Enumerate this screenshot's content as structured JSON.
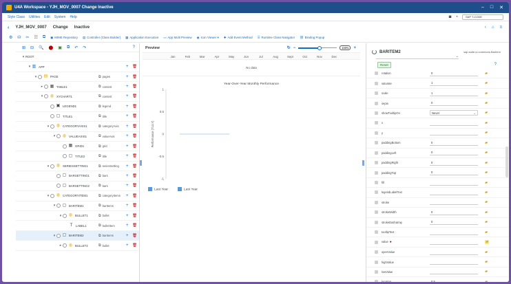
{
  "window": {
    "title": "U4A Workspace - YJH_MOV_0007 Change Inactive",
    "controls": [
      "–",
      "□",
      "✕"
    ]
  },
  "menubar": {
    "items": [
      "Style Class",
      "Utilities",
      "Edit",
      "System",
      "Help"
    ],
    "tcode_label": "SAP T-CODE"
  },
  "header": {
    "app_id": "YJH_MOV_0007",
    "mode": "Change",
    "status": "Inactive",
    "right_icons": [
      "‹",
      "⌂",
      "≡"
    ]
  },
  "app_toolbar": {
    "icons": [
      "⚙",
      "⛁",
      "✂",
      "☷",
      "⧉"
    ],
    "buttons": [
      {
        "icon": "▣",
        "label": "MIME Repository"
      },
      {
        "icon": "▤",
        "label": "Controller (Class Builder)"
      },
      {
        "icon": "▦",
        "label": "Application Execution"
      },
      {
        "icon": "▭",
        "label": "App Multi Preview"
      },
      {
        "icon": "◉",
        "label": "Icon Viewer ▾"
      },
      {
        "icon": "✚",
        "label": "Add Event Method"
      },
      {
        "icon": "☰",
        "label": "Runtime Class Navigator"
      },
      {
        "icon": "⛓",
        "label": "Binding Popup"
      }
    ]
  },
  "tree_toolbar": {
    "icons": [
      "⊞",
      "⊟",
      "🔍",
      "⬤",
      "▣",
      "⧉",
      "↶",
      "↷"
    ],
    "help": "?"
  },
  "tree": [
    {
      "indent": 0,
      "caret": "▾",
      "check": false,
      "icon": "",
      "icon_class": "",
      "name": "ROOT",
      "agg": "",
      "actions": false,
      "selected": false
    },
    {
      "indent": 1,
      "caret": "▾",
      "check": false,
      "icon": "▥",
      "icon_class": "ico-sap",
      "name": "APP",
      "agg": "",
      "actions": true,
      "selected": false
    },
    {
      "indent": 2,
      "caret": "▾",
      "check": true,
      "icon": "▤",
      "icon_class": "ico-yellow",
      "name": "PAGE",
      "agg": "pages",
      "actions": true,
      "selected": false
    },
    {
      "indent": 3,
      "caret": "▸",
      "check": true,
      "icon": "▦",
      "icon_class": "ico-dark",
      "name": "TABLE1",
      "agg": "content",
      "actions": true,
      "selected": false
    },
    {
      "indent": 3,
      "caret": "▾",
      "check": true,
      "icon": "◍",
      "icon_class": "ico-yellow",
      "name": "XYCHART1",
      "agg": "content",
      "actions": true,
      "selected": false
    },
    {
      "indent": 4,
      "caret": "",
      "check": true,
      "icon": "▣",
      "icon_class": "ico-dark",
      "name": "LEGEND1",
      "agg": "legend",
      "actions": true,
      "selected": false
    },
    {
      "indent": 4,
      "caret": "",
      "check": true,
      "icon": "▢",
      "icon_class": "ico-dark",
      "name": "TITLE1",
      "agg": "title",
      "actions": true,
      "selected": false
    },
    {
      "indent": 4,
      "caret": "▾",
      "check": true,
      "icon": "◍",
      "icon_class": "ico-yellow",
      "name": "CATEGORYAXIS1",
      "agg": "categoryAxis",
      "actions": true,
      "selected": false
    },
    {
      "indent": 5,
      "caret": "▾",
      "check": true,
      "icon": "◍",
      "icon_class": "ico-yellow",
      "name": "VALUEAXIS1",
      "agg": "valueAxis",
      "actions": true,
      "selected": false
    },
    {
      "indent": 6,
      "caret": "",
      "check": true,
      "icon": "▦",
      "icon_class": "ico-dark",
      "name": "GRID1",
      "agg": "grid",
      "actions": true,
      "selected": false
    },
    {
      "indent": 6,
      "caret": "",
      "check": true,
      "icon": "▢",
      "icon_class": "ico-dark",
      "name": "TITLE2",
      "agg": "title",
      "actions": true,
      "selected": false
    },
    {
      "indent": 4,
      "caret": "▾",
      "check": true,
      "icon": "◍",
      "icon_class": "ico-yellow",
      "name": "SERIESSETTING1",
      "agg": "seriesSetting",
      "actions": true,
      "selected": false
    },
    {
      "indent": 5,
      "caret": "",
      "check": true,
      "icon": "▢",
      "icon_class": "ico-dark",
      "name": "BARSETTING1",
      "agg": "bars",
      "actions": true,
      "selected": false
    },
    {
      "indent": 5,
      "caret": "",
      "check": true,
      "icon": "▢",
      "icon_class": "ico-dark",
      "name": "BARSETTING2",
      "agg": "bars",
      "actions": true,
      "selected": false
    },
    {
      "indent": 4,
      "caret": "▾",
      "check": true,
      "icon": "◍",
      "icon_class": "ico-yellow",
      "name": "CATEGORYITEM1",
      "agg": "categoryItems",
      "actions": true,
      "selected": false
    },
    {
      "indent": 5,
      "caret": "▾",
      "check": true,
      "icon": "▢",
      "icon_class": "ico-dark",
      "name": "BARITEM1",
      "agg": "barItems",
      "actions": true,
      "selected": false
    },
    {
      "indent": 6,
      "caret": "▾",
      "check": true,
      "icon": "◍",
      "icon_class": "ico-yellow",
      "name": "BULLET1",
      "agg": "bullet",
      "actions": true,
      "selected": false
    },
    {
      "indent": 7,
      "caret": "",
      "check": false,
      "icon": "T",
      "icon_class": "ico-dark",
      "name": "LABEL1",
      "agg": "bulletItem",
      "actions": true,
      "selected": false
    },
    {
      "indent": 5,
      "caret": "▾",
      "check": true,
      "icon": "▢",
      "icon_class": "ico-dark",
      "name": "BARITEM2",
      "agg": "barItems",
      "actions": true,
      "selected": true
    },
    {
      "indent": 6,
      "caret": "▸",
      "check": true,
      "icon": "◍",
      "icon_class": "ico-yellow",
      "name": "BULLET2",
      "agg": "bullet",
      "actions": true,
      "selected": false
    }
  ],
  "preview": {
    "title": "Preview",
    "zoom_label": "100%",
    "zoom_fraction": 0.55,
    "months": [
      "Jan",
      "Feb",
      "Mar",
      "Apr",
      "May",
      "Jun",
      "Jul",
      "Aug",
      "Sept",
      "Oct",
      "Nov",
      "Dec"
    ],
    "no_data": "No data"
  },
  "chart_data": {
    "type": "bar",
    "title": "Year-Over-Year Monthly Performance",
    "ylabel": "Performance (\\ud83d\\udcc8) (\\ud83d\\udccf)",
    "ylabel_display": "Performance (TL/LY)",
    "yticks": [
      1.0,
      0.5,
      0,
      -0.5,
      -1.0
    ],
    "ylim": [
      -1.0,
      1.0
    ],
    "categories": [],
    "series": [
      {
        "name": "Last Year",
        "values": []
      },
      {
        "name": "Last Year",
        "values": []
      }
    ],
    "legend_entries": [
      "Last Year",
      "Last Year"
    ],
    "legend_color": "#5899da",
    "zero_line_color": "#9ec3ea"
  },
  "properties_panel": {
    "title": "BARITEM2",
    "subtitle": "sap.suite.ui.commons.BarItem",
    "reset_label": "Reset",
    "help": "?",
    "rows": [
      {
        "name": "rotation",
        "value": "0",
        "type": "input",
        "required": false,
        "highlight": false
      },
      {
        "name": "saturate",
        "value": "1",
        "type": "input",
        "required": false,
        "highlight": false
      },
      {
        "name": "scale",
        "value": "1",
        "type": "input",
        "required": false,
        "highlight": false
      },
      {
        "name": "sepia",
        "value": "0",
        "type": "input",
        "required": false,
        "highlight": false
      },
      {
        "name": "showTooltipOn",
        "value": "Never",
        "type": "select",
        "required": false,
        "highlight": false
      },
      {
        "name": "x",
        "value": "",
        "type": "input",
        "required": false,
        "highlight": false
      },
      {
        "name": "y",
        "value": "",
        "type": "input",
        "required": false,
        "highlight": false
      },
      {
        "name": "paddingBottom",
        "value": "0",
        "type": "input",
        "required": false,
        "highlight": false
      },
      {
        "name": "paddingLeft",
        "value": "0",
        "type": "input",
        "required": false,
        "highlight": false
      },
      {
        "name": "paddingRight",
        "value": "0",
        "type": "input",
        "required": false,
        "highlight": false
      },
      {
        "name": "paddingTop",
        "value": "0",
        "type": "input",
        "required": false,
        "highlight": false
      },
      {
        "name": "fill",
        "value": "",
        "type": "input",
        "required": false,
        "highlight": false
      },
      {
        "name": "legendLabelText",
        "value": "",
        "type": "input",
        "required": false,
        "highlight": false
      },
      {
        "name": "stroke",
        "value": "",
        "type": "input",
        "required": false,
        "highlight": false
      },
      {
        "name": "strokeWidth",
        "value": "0",
        "type": "input",
        "required": false,
        "highlight": false
      },
      {
        "name": "strokeDasharray",
        "value": "0",
        "type": "input",
        "required": false,
        "highlight": false
      },
      {
        "name": "tooltipText",
        "value": "",
        "type": "input",
        "required": false,
        "highlight": false
      },
      {
        "name": "value",
        "value": "",
        "type": "input",
        "required": true,
        "highlight": true
      },
      {
        "name": "openValue",
        "value": "",
        "type": "input",
        "required": false,
        "highlight": false
      },
      {
        "name": "highValue",
        "value": "",
        "type": "input",
        "required": false,
        "highlight": false
      },
      {
        "name": "lowValue",
        "value": "",
        "type": "input",
        "required": false,
        "highlight": false
      },
      {
        "name": "location",
        "value": "0.5",
        "type": "input",
        "required": false,
        "highlight": false
      }
    ]
  }
}
